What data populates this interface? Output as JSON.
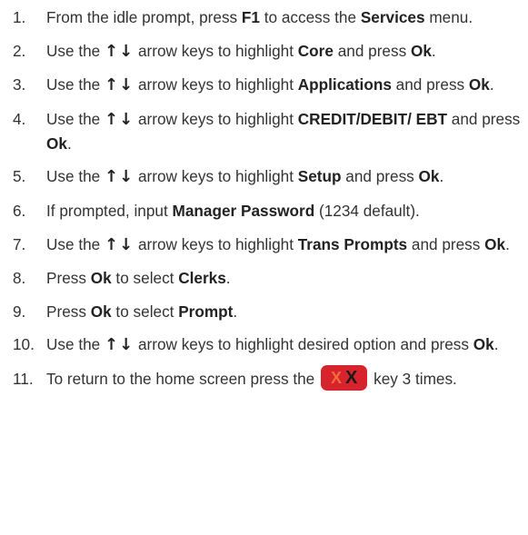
{
  "steps": [
    {
      "num": "1.",
      "parts": [
        {
          "t": "From the idle prompt, press "
        },
        {
          "t": "F1",
          "b": true
        },
        {
          "t": " to access the "
        },
        {
          "t": "Services",
          "b": true
        },
        {
          "t": " menu."
        }
      ]
    },
    {
      "num": "2.",
      "parts": [
        {
          "t": "Use the "
        },
        {
          "arrows": "↑↓"
        },
        {
          "t": " arrow keys to highlight "
        },
        {
          "t": "Core",
          "b": true
        },
        {
          "t": " and press "
        },
        {
          "t": "Ok",
          "b": true
        },
        {
          "t": "."
        }
      ]
    },
    {
      "num": "3.",
      "parts": [
        {
          "t": "Use the "
        },
        {
          "arrows": "↑↓"
        },
        {
          "t": " arrow keys to highlight "
        },
        {
          "t": "Applications",
          "b": true
        },
        {
          "t": " and press "
        },
        {
          "t": "Ok",
          "b": true
        },
        {
          "t": "."
        }
      ]
    },
    {
      "num": "4.",
      "parts": [
        {
          "t": "Use the "
        },
        {
          "arrows": "↑↓"
        },
        {
          "t": " arrow keys to highlight "
        },
        {
          "t": "CREDIT/DEBIT/ EBT",
          "b": true
        },
        {
          "t": " and press "
        },
        {
          "t": "Ok",
          "b": true
        },
        {
          "t": "."
        }
      ]
    },
    {
      "num": "5.",
      "parts": [
        {
          "t": "Use the "
        },
        {
          "arrows": "↑↓"
        },
        {
          "t": " arrow keys to highlight "
        },
        {
          "t": "Setup",
          "b": true
        },
        {
          "t": " and press "
        },
        {
          "t": "Ok",
          "b": true
        },
        {
          "t": "."
        }
      ]
    },
    {
      "num": "6.",
      "parts": [
        {
          "t": "If prompted, input "
        },
        {
          "t": "Manager Password",
          "b": true
        },
        {
          "t": " (1234 default)."
        }
      ]
    },
    {
      "num": "7.",
      "parts": [
        {
          "t": "Use the "
        },
        {
          "arrows": "↑↓"
        },
        {
          "t": " arrow keys to highlight "
        },
        {
          "t": "Trans Prompts",
          "b": true
        },
        {
          "t": " and press "
        },
        {
          "t": "Ok",
          "b": true
        },
        {
          "t": "."
        }
      ]
    },
    {
      "num": "8.",
      "parts": [
        {
          "t": "Press "
        },
        {
          "t": "Ok",
          "b": true
        },
        {
          "t": " to select "
        },
        {
          "t": "Clerks",
          "b": true
        },
        {
          "t": "."
        }
      ]
    },
    {
      "num": "9.",
      "parts": [
        {
          "t": "Press "
        },
        {
          "t": "Ok",
          "b": true
        },
        {
          "t": " to select "
        },
        {
          "t": "Prompt",
          "b": true
        },
        {
          "t": "."
        }
      ]
    },
    {
      "num": "10.",
      "parts": [
        {
          "t": "Use the "
        },
        {
          "arrows": "↑↓"
        },
        {
          "t": " arrow keys to highlight desired option and press "
        },
        {
          "t": "Ok",
          "b": true
        },
        {
          "t": "."
        }
      ]
    },
    {
      "num": "11.",
      "parts": [
        {
          "t": "To return to the home screen press the "
        },
        {
          "key": [
            "X",
            "X"
          ]
        },
        {
          "t": " key 3 times."
        }
      ]
    }
  ],
  "colors": {
    "text": "#333333",
    "key_background": "#d7232c",
    "key_small_x": "#f26b3a",
    "key_big_x": "#1a1a1a"
  },
  "icons": {
    "arrows": "up-down-arrow-keys-icon",
    "key": "cancel-x-key-icon"
  }
}
